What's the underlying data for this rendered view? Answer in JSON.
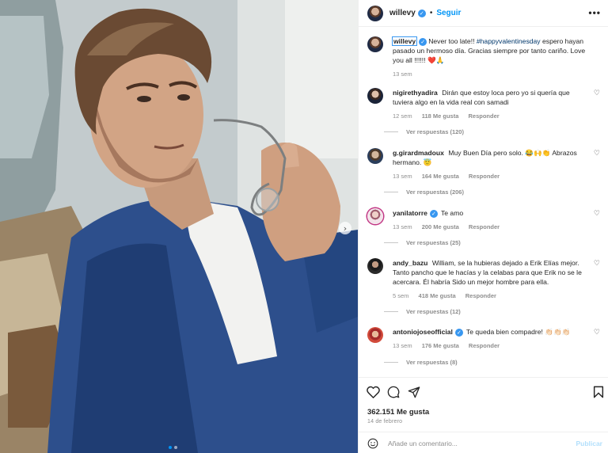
{
  "post": {
    "username": "willevy",
    "follow_label": "Seguir",
    "header_separator": "•",
    "more_label": "•••",
    "carousel_next": "›"
  },
  "caption": {
    "username": "willevy",
    "text_a": "Never too late!! ",
    "hashtag": "#happyvalentinesday",
    "text_b": " espero hayan pasado un hermoso día. Gracias siempre por tanto cariño. Love you all !!!!!! ❤️🙏",
    "time": "13 sem"
  },
  "comments": [
    {
      "username": "nigirethyadira",
      "verified": false,
      "text": "Dirán que estoy loca pero yo si quería que tuviera algo en la vida real con samadi",
      "time": "12 sem",
      "likes": "118 Me gusta",
      "reply": "Responder",
      "view_replies": "Ver respuestas (120)"
    },
    {
      "username": "g.girardmadoux",
      "verified": false,
      "text": "Muy Buen Día pero solo. 😂🙌👏 Abrazos hermano. 😇",
      "time": "13 sem",
      "likes": "164 Me gusta",
      "reply": "Responder",
      "view_replies": "Ver respuestas (206)"
    },
    {
      "username": "yanilatorre",
      "verified": true,
      "text": "Te amo",
      "time": "13 sem",
      "likes": "200 Me gusta",
      "reply": "Responder",
      "view_replies": "Ver respuestas (25)"
    },
    {
      "username": "andy_bazu",
      "verified": false,
      "text": "William, se la hubieras dejado a Erik Elías mejor. Tanto pancho que le hacías y la celabas para que Erik no se le acercara. Él habría Sido un mejor hombre para ella.",
      "time": "5 sem",
      "likes": "418 Me gusta",
      "reply": "Responder",
      "view_replies": "Ver respuestas (12)"
    },
    {
      "username": "antoniojoseofficial",
      "verified": true,
      "text": "Te queda bien compadre! 👏🏻👏🏻👏🏻",
      "time": "13 sem",
      "likes": "176 Me gusta",
      "reply": "Responder",
      "view_replies": "Ver respuestas (8)"
    }
  ],
  "actions": {
    "like_count": "362.151 Me gusta",
    "date": "14 de febrero",
    "comment_placeholder": "Añade un comentario...",
    "publish_label": "Publicar"
  },
  "icons": {
    "verified": "✓",
    "heart": "♡"
  },
  "colors": {
    "accent": "#0095f6",
    "verified": "#3897f0",
    "muted": "#8e8e8e",
    "text": "#262626",
    "publish_disabled": "#b2dffc"
  }
}
